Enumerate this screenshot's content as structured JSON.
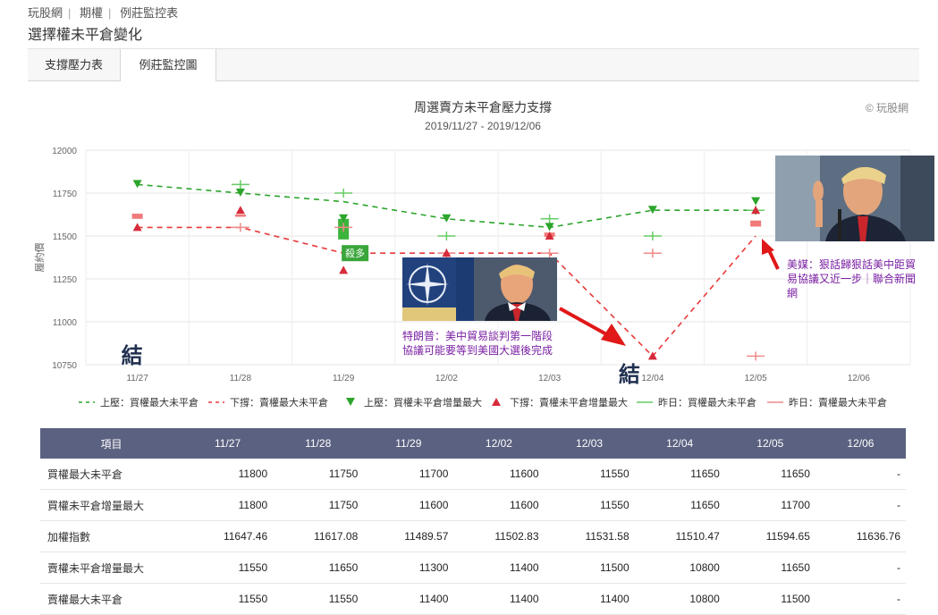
{
  "breadcrumb": [
    "玩股網",
    "期權",
    "例莊監控表"
  ],
  "page_title": "選擇權未平倉變化",
  "tabs": [
    {
      "label": "支撐壓力表"
    },
    {
      "label": "例莊監控圖"
    }
  ],
  "chart_data": {
    "type": "line",
    "title": "周選賣方未平倉壓力支撐",
    "subtitle": "2019/11/27 - 2019/12/06",
    "credit": "© 玩股網",
    "ylabel": "履約價",
    "xlabel": "",
    "categories": [
      "11/27",
      "11/28",
      "11/29",
      "12/02",
      "12/03",
      "12/04",
      "12/05",
      "12/06"
    ],
    "ylim": [
      10750,
      12000
    ],
    "yticks": [
      10750,
      11000,
      11250,
      11500,
      11750,
      12000
    ],
    "series": [
      {
        "name": "上壓：買權最大未平倉",
        "style": "dashed-line",
        "color": "#2ca52c",
        "values": [
          11800,
          11750,
          11700,
          11600,
          11550,
          11650,
          11650,
          null
        ]
      },
      {
        "name": "下撐：賣權最大未平倉",
        "style": "dashed-line",
        "color": "#e83a3a",
        "values": [
          11550,
          11550,
          11400,
          11400,
          11400,
          10800,
          11500,
          null
        ]
      },
      {
        "name": "上壓：買權未平倉增量最大",
        "style": "down-triangle",
        "color": "#2ca52c",
        "values": [
          11800,
          11750,
          11600,
          11600,
          11550,
          11650,
          11700,
          null
        ]
      },
      {
        "name": "下撐：賣權未平倉增量最大",
        "style": "up-triangle",
        "color": "#d62b3a",
        "values": [
          11550,
          11650,
          11300,
          11400,
          11500,
          10800,
          11650,
          null
        ]
      },
      {
        "name": "昨日：買權最大未平倉",
        "style": "short-line",
        "color": "#66cc66",
        "values": [
          null,
          11800,
          11750,
          11500,
          11600,
          11500,
          11650,
          11650
        ]
      },
      {
        "name": "昨日：賣權最大未平倉",
        "style": "short-line",
        "color": "#f08a8a",
        "values": [
          null,
          11550,
          11550,
          11400,
          11400,
          11400,
          10800,
          11500
        ]
      }
    ],
    "candles": [
      {
        "x": "11/27",
        "open": 11630,
        "close": 11600,
        "color": "#f07a7a"
      },
      {
        "x": "11/28",
        "open": 11625,
        "close": 11612,
        "color": "#f07a7a"
      },
      {
        "x": "11/29",
        "open": 11600,
        "close": 11480,
        "color": "#3cb43c"
      },
      {
        "x": "12/03",
        "open": 11520,
        "close": 11495,
        "color": "#f07a7a"
      },
      {
        "x": "12/05",
        "open": 11590,
        "close": 11555,
        "color": "#f07a7a"
      }
    ],
    "flag_label": "殺多",
    "legend_position": "bottom"
  },
  "annotations": {
    "settle_mark": "結",
    "caption1": "特朗普：美中貿易談判第一階段協議可能要等到美國大選後完成",
    "caption2": "美媒：狠話歸狠話美中距貿易協議又近一步｜聯合新聞網"
  },
  "table": {
    "headers": [
      "項目",
      "11/27",
      "11/28",
      "11/29",
      "12/02",
      "12/03",
      "12/04",
      "12/05",
      "12/06"
    ],
    "rows": [
      [
        "買權最大未平倉",
        "11800",
        "11750",
        "11700",
        "11600",
        "11550",
        "11650",
        "11650",
        "-"
      ],
      [
        "買權未平倉增量最大",
        "11800",
        "11750",
        "11600",
        "11600",
        "11550",
        "11650",
        "11700",
        "-"
      ],
      [
        "加權指數",
        "11647.46",
        "11617.08",
        "11489.57",
        "11502.83",
        "11531.58",
        "11510.47",
        "11594.65",
        "11636.76"
      ],
      [
        "賣權未平倉增量最大",
        "11550",
        "11650",
        "11300",
        "11400",
        "11500",
        "10800",
        "11650",
        "-"
      ],
      [
        "賣權最大未平倉",
        "11550",
        "11550",
        "11400",
        "11400",
        "11400",
        "10800",
        "11500",
        "-"
      ]
    ]
  }
}
